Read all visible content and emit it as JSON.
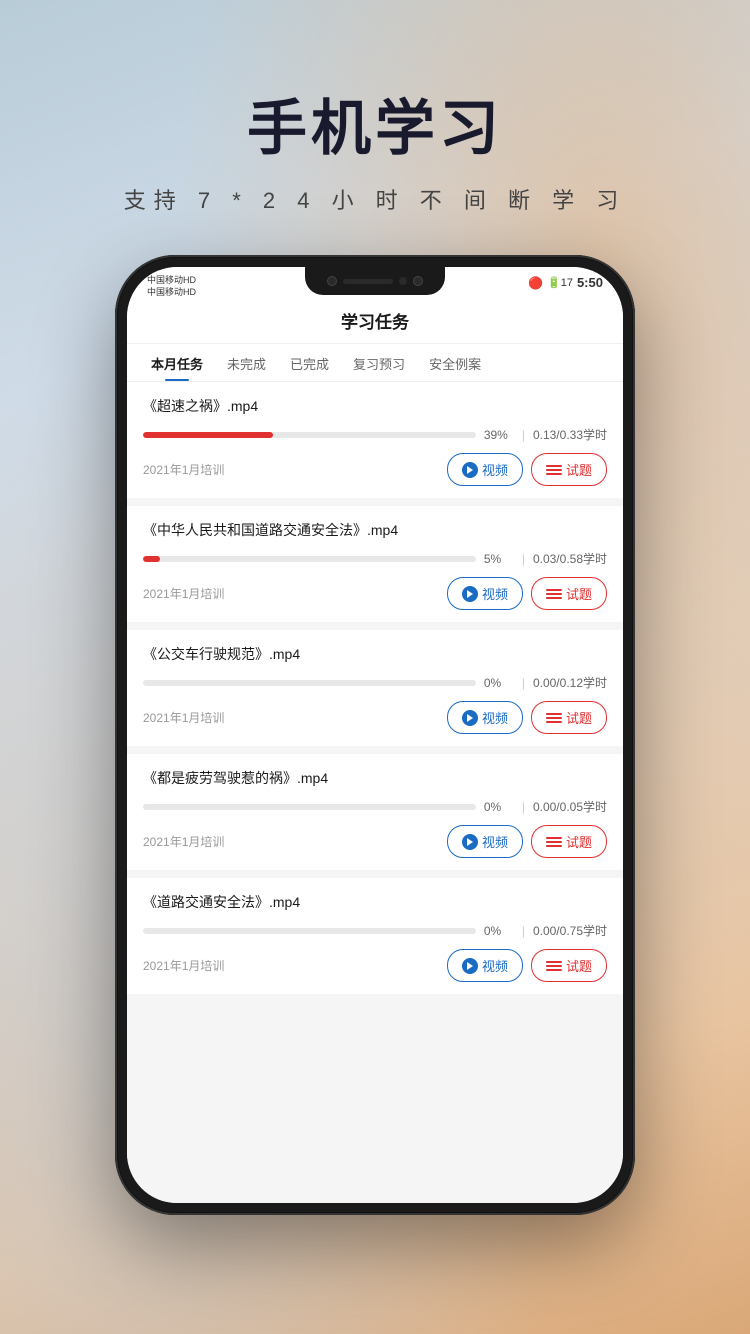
{
  "header": {
    "main_title": "手机学习",
    "sub_title": "支持 7 * 2 4 小 时 不 间 断 学 习"
  },
  "app": {
    "title": "学习任务",
    "status_bar": {
      "carrier1": "中国移动HD",
      "carrier2": "中国移动HD",
      "time": "5:50",
      "battery": "17"
    },
    "tabs": [
      {
        "label": "本月任务",
        "active": true
      },
      {
        "label": "未完成",
        "active": false
      },
      {
        "label": "已完成",
        "active": false
      },
      {
        "label": "复习预习",
        "active": false
      },
      {
        "label": "安全例案",
        "active": false
      }
    ],
    "courses": [
      {
        "title": "《超速之祸》.mp4",
        "progress": 39,
        "progress_text": "39%",
        "hours": "0.13/0.33学时",
        "training_date": "2021年1月培训",
        "progress_color": "#e03030",
        "btn_video": "视频",
        "btn_exam": "试题"
      },
      {
        "title": "《中华人民共和国道路交通安全法》.mp4",
        "progress": 5,
        "progress_text": "5%",
        "hours": "0.03/0.58学时",
        "training_date": "2021年1月培训",
        "progress_color": "#e03030",
        "btn_video": "视频",
        "btn_exam": "试题"
      },
      {
        "title": "《公交车行驶规范》.mp4",
        "progress": 0,
        "progress_text": "0%",
        "hours": "0.00/0.12学时",
        "training_date": "2021年1月培训",
        "progress_color": "#e8e8e8",
        "btn_video": "视频",
        "btn_exam": "试题"
      },
      {
        "title": "《都是疲劳驾驶惹的祸》.mp4",
        "progress": 0,
        "progress_text": "0%",
        "hours": "0.00/0.05学时",
        "training_date": "2021年1月培训",
        "progress_color": "#e8e8e8",
        "btn_video": "视频",
        "btn_exam": "试题"
      },
      {
        "title": "《道路交通安全法》.mp4",
        "progress": 0,
        "progress_text": "0%",
        "hours": "0.00/0.75学时",
        "training_date": "2021年1月培训",
        "progress_color": "#e8e8e8",
        "btn_video": "视频",
        "btn_exam": "试题"
      }
    ]
  }
}
